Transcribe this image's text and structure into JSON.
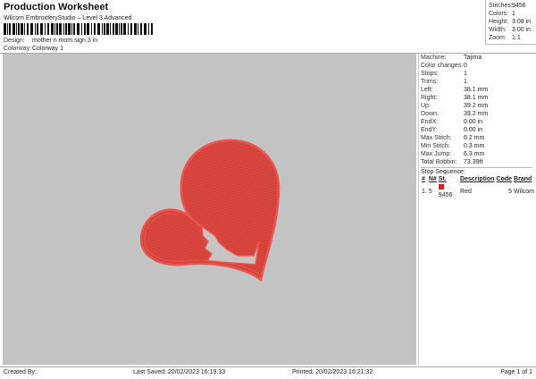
{
  "header": {
    "title": "Production Worksheet",
    "subtitle": "Wilcom EmbroideryStudio – Level 3 Advanced",
    "design_label": "Design:",
    "design_value": "mother n mom sign 3 in",
    "colorway_label": "Colorway:",
    "colorway_value": "Colorway 1"
  },
  "summary": [
    {
      "k": "Stitches:",
      "v": "9456"
    },
    {
      "k": "Colors:",
      "v": "1"
    },
    {
      "k": "Height:",
      "v": "3.08 in"
    },
    {
      "k": "Width:",
      "v": "3.00 in"
    },
    {
      "k": "Zoom:",
      "v": "1:1"
    }
  ],
  "details": [
    {
      "k": "Machine:",
      "v": "Tajima"
    },
    {
      "k": "Color changes:",
      "v": "0"
    },
    {
      "k": "Stops:",
      "v": "1"
    },
    {
      "k": "Trims:",
      "v": "1"
    },
    {
      "k": "Left:",
      "v": "38.1 mm"
    },
    {
      "k": "Right:",
      "v": "38.1 mm"
    },
    {
      "k": "Up:",
      "v": "39.2 mm"
    },
    {
      "k": "Down:",
      "v": "39.2 mm"
    },
    {
      "k": "EndX:",
      "v": "0.00 in"
    },
    {
      "k": "EndY:",
      "v": "0.00 in"
    },
    {
      "k": "Max Stitch:",
      "v": "6.2 mm"
    },
    {
      "k": "Min Stitch:",
      "v": "0.3 mm"
    },
    {
      "k": "Max Jump:",
      "v": "6.3 mm"
    },
    {
      "k": "Total Bobbin:",
      "v": "73.39ft"
    }
  ],
  "stop_sequence": {
    "label": "Stop Sequence:",
    "headers": [
      "#",
      "N#",
      "St.",
      "Description",
      "Code",
      "Brand"
    ],
    "rows": [
      {
        "num": "1.",
        "n": "5",
        "st": "9456",
        "desc": "Red",
        "code": "5",
        "brand": "Wilcom",
        "color": "#e02020"
      }
    ]
  },
  "design_colors": {
    "fill": "#d9453f",
    "outline": "#e05048",
    "background": "#c3c3c3"
  },
  "footer": {
    "created": "Created By:",
    "saved": "Last Saved: 20/02/2023 16:19:33",
    "printed": "Printed: 20/02/2023 16:21:32",
    "page": "Page 1 of 1"
  }
}
